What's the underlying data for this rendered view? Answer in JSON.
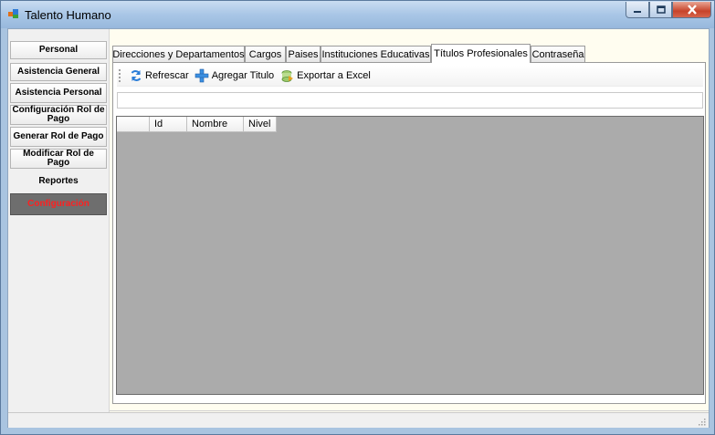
{
  "window": {
    "title": "Talento Humano"
  },
  "sidebar": {
    "items": [
      {
        "label": "Personal"
      },
      {
        "label": "Asistencia General"
      },
      {
        "label": "Asistencia Personal"
      },
      {
        "label": "Configuración Rol de Pago"
      },
      {
        "label": "Generar Rol de Pago"
      },
      {
        "label": "Modificar Rol de Pago"
      },
      {
        "label": "Reportes"
      },
      {
        "label": "Configuración"
      }
    ],
    "active_color": "#ff2020"
  },
  "tabs": [
    {
      "label": "Direcciones y Departamentos"
    },
    {
      "label": "Cargos"
    },
    {
      "label": "Paises"
    },
    {
      "label": "Instituciones Educativas"
    },
    {
      "label": "Títulos Profesionales"
    },
    {
      "label": "Contraseña"
    }
  ],
  "selected_tab": "Títulos Profesionales",
  "toolbar": {
    "refresh_label": "Refrescar",
    "refresh_icon": "refresh-icon",
    "add_label": "Agregar Titulo",
    "add_icon": "plus-icon",
    "export_label": "Exportar a Excel",
    "export_icon": "excel-icon"
  },
  "search": {
    "value": ""
  },
  "grid": {
    "columns": [
      "Id",
      "Nombre",
      "Nivel"
    ],
    "rows": []
  }
}
